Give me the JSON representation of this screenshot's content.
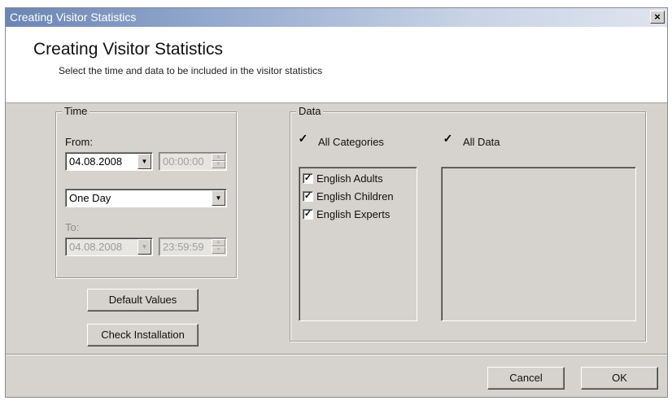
{
  "window": {
    "title": "Creating Visitor Statistics",
    "close_glyph": "×"
  },
  "header": {
    "title": "Creating Visitor Statistics",
    "subtitle": "Select the time and data to be included in the visitor statistics"
  },
  "time_group": {
    "label": "Time",
    "from_label": "From:",
    "from_date": "04.08.2008",
    "from_time": "00:00:00",
    "period": "One Day",
    "to_label": "To:",
    "to_date": "04.08.2008",
    "to_time": "23:59:59"
  },
  "buttons": {
    "default_values": "Default Values",
    "check_installation": "Check Installation",
    "cancel": "Cancel",
    "ok": "OK"
  },
  "data_group": {
    "label": "Data",
    "all_categories": {
      "label": "All Categories",
      "checked": true
    },
    "all_data": {
      "label": "All Data",
      "checked": true
    },
    "categories": [
      {
        "label": "English Adults",
        "checked": true
      },
      {
        "label": "English Children",
        "checked": true
      },
      {
        "label": "English Experts",
        "checked": true
      }
    ]
  },
  "glyphs": {
    "check": "✓",
    "arrow_down": "▼",
    "arrow_up": "▲"
  }
}
